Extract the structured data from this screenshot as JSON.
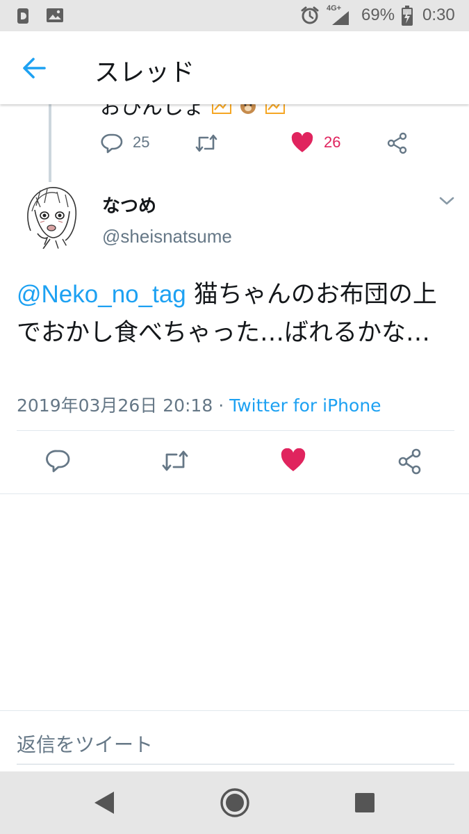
{
  "status_bar": {
    "network": "4G+",
    "battery_pct": "69%",
    "time": "0:30"
  },
  "header": {
    "back_icon": "arrow-left-icon",
    "title": "スレッド"
  },
  "previous_tweet": {
    "text_partial": "おひんしょ",
    "reply_count": "25",
    "like_count": "26",
    "liked": true
  },
  "tweet": {
    "display_name": "なつめ",
    "handle": "@sheisnatsume",
    "mention": "@Neko_no_tag",
    "body": " 猫ちゃんのお布団の上でおかし食べちゃった…ばれるかな…",
    "timestamp": "2019年03月26日 20:18",
    "separator": " · ",
    "client": "Twitter for iPhone",
    "liked": true
  },
  "reply_bar": {
    "placeholder": "返信をツイート"
  },
  "colors": {
    "accent": "#1da1f2",
    "like": "#e0245e",
    "icon_gray": "#657786"
  },
  "nav_bar": {
    "icons": [
      "back-triangle-icon",
      "home-circle-icon",
      "recents-square-icon"
    ]
  }
}
